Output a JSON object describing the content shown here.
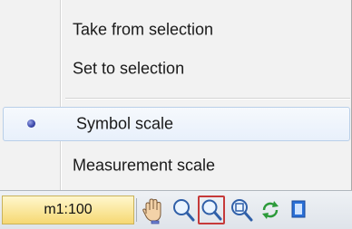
{
  "menu": {
    "items": [
      {
        "label": "Take from selection"
      },
      {
        "label": "Set to selection"
      },
      {
        "label": "Symbol scale",
        "checked": true
      },
      {
        "label": "Measurement scale"
      }
    ]
  },
  "toolbar": {
    "scale_label": "m1:100",
    "icons": [
      "pan-hand-icon",
      "zoom-icon",
      "zoom-window-icon",
      "zoom-fit-icon",
      "refresh-icon",
      "next-icon"
    ]
  },
  "colors": {
    "menu_background": "#f2f2f2",
    "checked_highlight": "#e8f0fb",
    "radio_dot": "#3f4cae",
    "scale_box": "#f6d873",
    "active_button_border": "#c63a3a"
  }
}
